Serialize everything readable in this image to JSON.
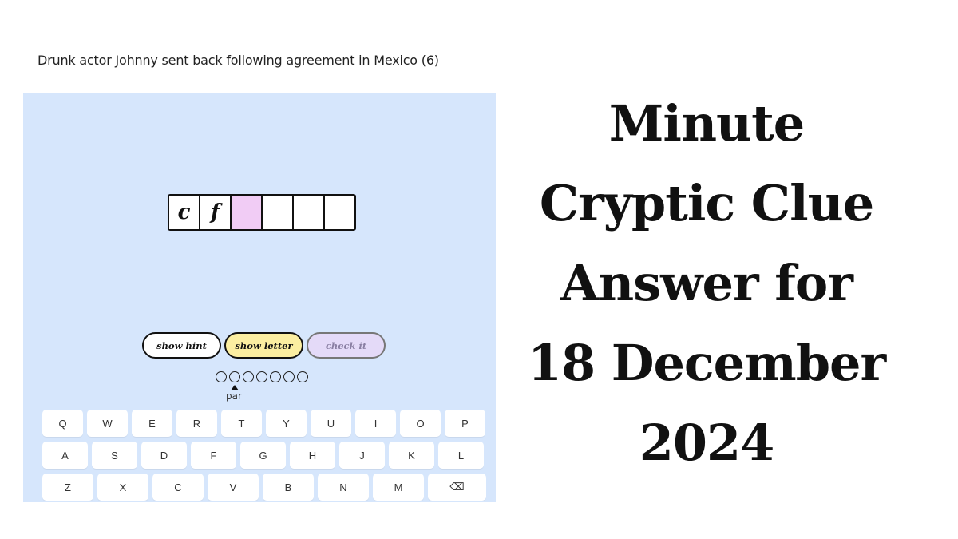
{
  "clue": {
    "text": "Drunk actor Johnny sent back following agreement in Mexico (6)",
    "answer_length": 6
  },
  "grid": {
    "cells": [
      "c",
      "f",
      "",
      "",
      "",
      ""
    ],
    "active_index": 2
  },
  "buttons": {
    "hint": "show hint",
    "letter": "show letter",
    "check": "check it"
  },
  "progress": {
    "dots_total": 7,
    "par_label": "par",
    "par_index": 1
  },
  "keyboard": {
    "row1": [
      "Q",
      "W",
      "E",
      "R",
      "T",
      "Y",
      "U",
      "I",
      "O",
      "P"
    ],
    "row2": [
      "A",
      "S",
      "D",
      "F",
      "G",
      "H",
      "J",
      "K",
      "L"
    ],
    "row3": [
      "Z",
      "X",
      "C",
      "V",
      "B",
      "N",
      "M",
      "⌫"
    ]
  },
  "headline": {
    "lines": [
      "Minute",
      "Cryptic Clue",
      "Answer for",
      "18 December",
      "2024"
    ]
  },
  "colors": {
    "panel_bg": "#d6e6fc",
    "active_cell": "#f1ccf5",
    "letter_button": "#fbeea1",
    "check_button": "#e4daf8"
  }
}
